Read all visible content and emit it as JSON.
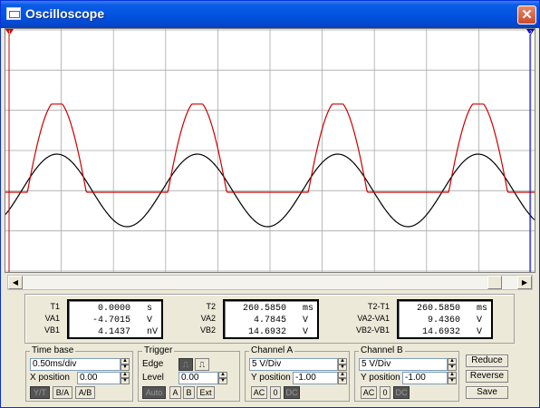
{
  "window": {
    "title": "Oscilloscope",
    "close_glyph": "✕"
  },
  "scope": {
    "cursor_t1_label": "1",
    "cursor_t2_label": "2",
    "colors": {
      "channel_a": "#cc0000",
      "channel_b": "#000000",
      "grid": "#a9a9a9"
    }
  },
  "readouts": {
    "t1": {
      "labels": [
        "T1",
        "VA1",
        "VB1"
      ],
      "values": [
        "0.0000",
        "-4.7015",
        "4.1437"
      ],
      "units": [
        "s",
        "V",
        "nV"
      ]
    },
    "t2": {
      "labels": [
        "T2",
        "VA2",
        "VB2"
      ],
      "values": [
        "260.5850",
        "4.7845",
        "14.6932"
      ],
      "units": [
        "ms",
        "V",
        "V"
      ]
    },
    "diff": {
      "labels": [
        "T2-T1",
        "VA2-VA1",
        "VB2-VB1"
      ],
      "values": [
        "260.5850",
        "9.4360",
        "14.6932"
      ],
      "units": [
        "ms",
        "V",
        "V"
      ]
    }
  },
  "timebase": {
    "title": "Time base",
    "scale": "0.50ms/div",
    "xpos_label": "X position",
    "xpos": "0.00",
    "modes": [
      "Y/T",
      "B/A",
      "A/B"
    ]
  },
  "trigger": {
    "title": "Trigger",
    "edge_label": "Edge",
    "level_label": "Level",
    "level": "0.00",
    "buttons": [
      "Auto",
      "A",
      "B",
      "Ext"
    ]
  },
  "channel_a": {
    "title": "Channel A",
    "scale": "5 V/Div",
    "ypos_label": "Y position",
    "ypos": "-1.00",
    "coupling": [
      "AC",
      "0",
      "DC"
    ]
  },
  "channel_b": {
    "title": "Channel B",
    "scale": "5 V/Div",
    "ypos_label": "Y position",
    "ypos": "-1.00",
    "coupling": [
      "AC",
      "0",
      "DC"
    ]
  },
  "actions": {
    "reduce": "Reduce",
    "reverse": "Reverse",
    "save": "Save"
  }
}
